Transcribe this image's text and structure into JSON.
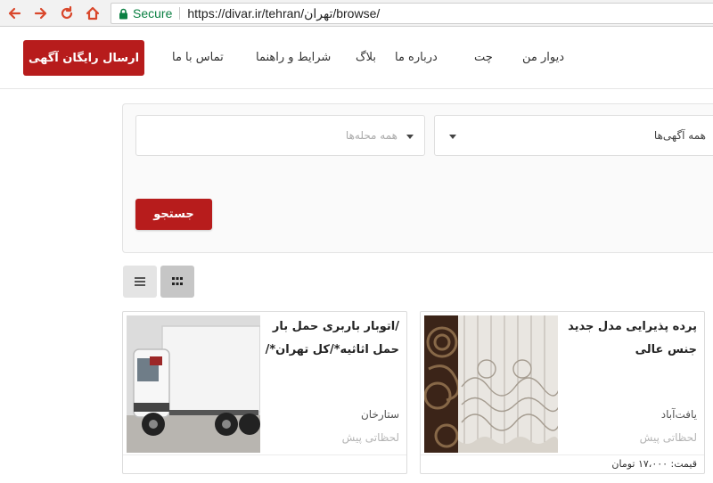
{
  "browser": {
    "secure_label": "Secure",
    "url": "https://divar.ir/tehran/تهران/browse/"
  },
  "header": {
    "post_ad_label": "ارسال رایگان آگهی",
    "nav": [
      {
        "label": "دیوار من"
      },
      {
        "label": "چت"
      },
      {
        "label": "درباره ما"
      },
      {
        "label": "بلاگ"
      },
      {
        "label": "شرایط و راهنما"
      },
      {
        "label": "تماس با ما"
      }
    ]
  },
  "search": {
    "category_value": "همه آگهی‌ها",
    "district_placeholder": "همه محله‌ها",
    "submit_label": "جستجو"
  },
  "ads": [
    {
      "title": "پرده پذیرایی مدل جدید جنس عالی",
      "location": "یافت‌آباد",
      "time": "لحظاتی پیش",
      "price": "قیمت: ۱۷،۰۰۰ تومان"
    },
    {
      "title": "/اتوبار باربری حمل بار حمل اثاثیه*/کل تهران*/",
      "location": "ستارخان",
      "time": "لحظاتی پیش"
    }
  ],
  "icons": {
    "back": "back-arrow-icon",
    "forward": "forward-arrow-icon",
    "reload": "reload-icon",
    "home": "home-icon",
    "lock": "lock-icon",
    "list_view": "list-view-icon",
    "grid_view": "grid-view-icon",
    "dropdown": "caret-down-icon"
  },
  "colors": {
    "brand_red": "#b71c1c",
    "secure_green": "#0b8043",
    "nav_arrow_red": "#d9472b"
  }
}
